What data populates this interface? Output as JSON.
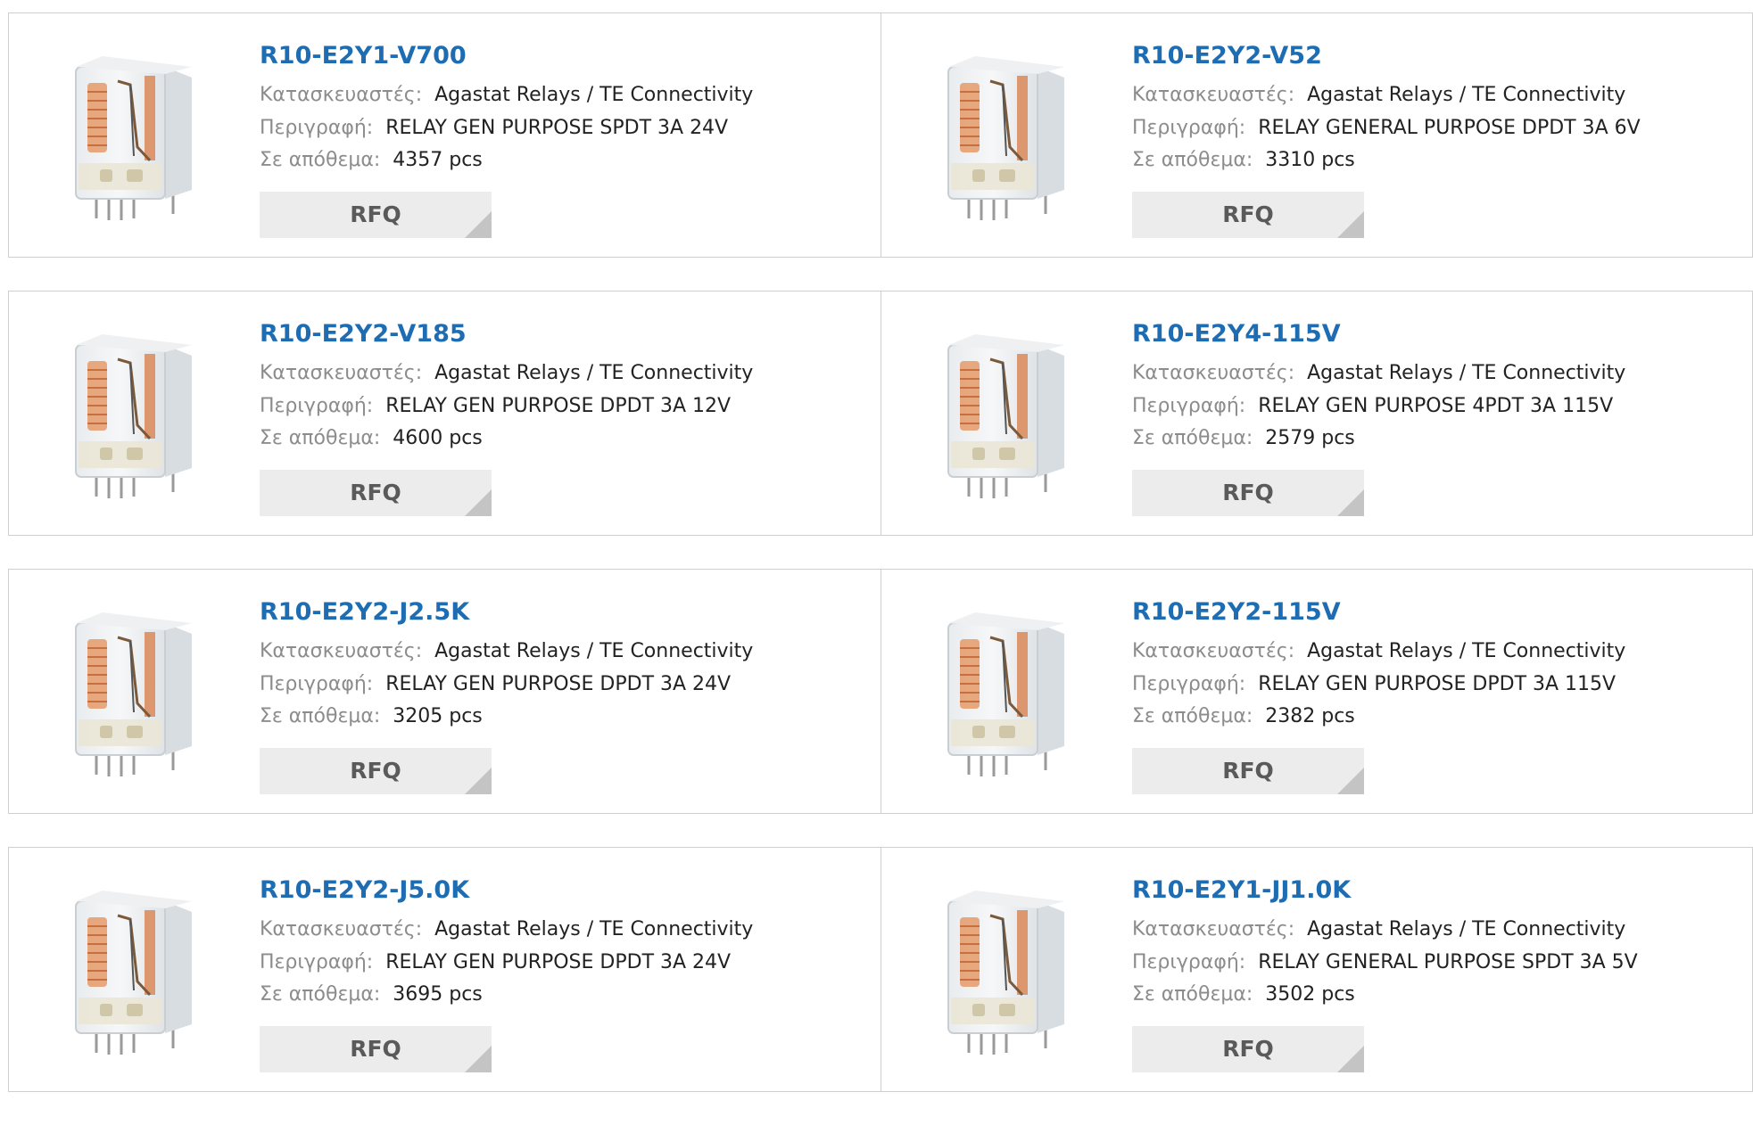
{
  "labels": {
    "manufacturer": "Κατασκευαστές:",
    "description": "Περιγραφή:",
    "stock": "Σε απόθεμα:",
    "rfq": "RFQ"
  },
  "products": [
    {
      "part": "R10-E2Y1-V700",
      "manufacturer": "Agastat Relays / TE Connectivity",
      "description": "RELAY GEN PURPOSE SPDT 3A 24V",
      "stock": "4357 pcs",
      "image_icon": "relay-photo-angled"
    },
    {
      "part": "R10-E2Y2-V52",
      "manufacturer": "Agastat Relays / TE Connectivity",
      "description": "RELAY GENERAL PURPOSE DPDT 3A 6V",
      "stock": "3310 pcs",
      "image_icon": "relay-photo"
    },
    {
      "part": "R10-E2Y2-V185",
      "manufacturer": "Agastat Relays / TE Connectivity",
      "description": "RELAY GEN PURPOSE DPDT 3A 12V",
      "stock": "4600 pcs",
      "image_icon": "relay-photo"
    },
    {
      "part": "R10-E2Y4-115V",
      "manufacturer": "Agastat Relays / TE Connectivity",
      "description": "RELAY GEN PURPOSE 4PDT 3A 115V",
      "stock": "2579 pcs",
      "image_icon": "relay-photo"
    },
    {
      "part": "R10-E2Y2-J2.5K",
      "manufacturer": "Agastat Relays / TE Connectivity",
      "description": "RELAY GEN PURPOSE DPDT 3A 24V",
      "stock": "3205 pcs",
      "image_icon": "relay-photo"
    },
    {
      "part": "R10-E2Y2-115V",
      "manufacturer": "Agastat Relays / TE Connectivity",
      "description": "RELAY GEN PURPOSE DPDT 3A 115V",
      "stock": "2382 pcs",
      "image_icon": "relay-photo"
    },
    {
      "part": "R10-E2Y2-J5.0K",
      "manufacturer": "Agastat Relays / TE Connectivity",
      "description": "RELAY GEN PURPOSE DPDT 3A 24V",
      "stock": "3695 pcs",
      "image_icon": "relay-photo"
    },
    {
      "part": "R10-E2Y1-JJ1.0K",
      "manufacturer": "Agastat Relays / TE Connectivity",
      "description": "RELAY GENERAL PURPOSE SPDT 3A 5V",
      "stock": "3502 pcs",
      "image_icon": "relay-photo"
    }
  ],
  "colors": {
    "link": "#1e6db3",
    "label": "#8c8c8c",
    "border": "#cfcfcf",
    "button_bg": "#ececec",
    "button_text": "#5a5a5a"
  }
}
